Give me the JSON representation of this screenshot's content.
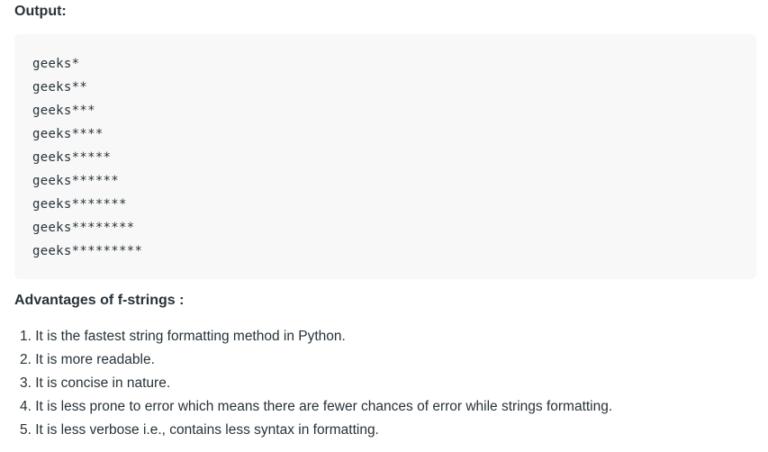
{
  "output_heading": "Output:",
  "code_output": [
    "geeks*",
    "geeks**",
    "geeks***",
    "geeks****",
    "geeks*****",
    "geeks******",
    "geeks*******",
    "geeks********",
    "geeks*********"
  ],
  "advantages_heading": "Advantages of f-strings :",
  "advantages": [
    "1. It is the fastest string formatting method in Python.",
    "2. It is more readable.",
    "3. It is concise in nature.",
    "4. It is less prone to error which means there are fewer chances of error while strings formatting.",
    "5. It is less verbose i.e., contains less syntax in formatting."
  ],
  "colors": {
    "text": "#273239",
    "code_background": "#f8f8f8"
  }
}
